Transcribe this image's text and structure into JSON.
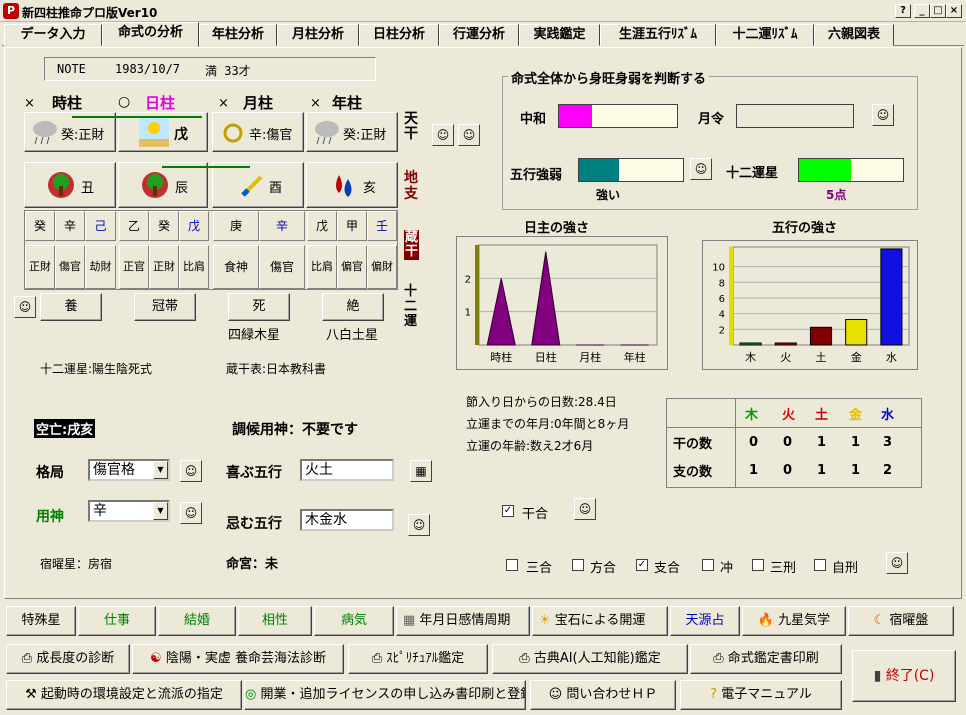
{
  "window": {
    "title": "新四柱推命プロ版Ver10",
    "help": "?",
    "min": "_",
    "max": "□",
    "close": "×",
    "app_icon": "P"
  },
  "tabs": [
    "データ入力",
    "命式の分析",
    "年柱分析",
    "月柱分析",
    "日柱分析",
    "行運分析",
    "実践鑑定",
    "生涯五行ﾘｽﾞﾑ",
    "十二運ﾘｽﾞﾑ",
    "六親図表"
  ],
  "note": {
    "label": "NOTE",
    "date": "1983/10/7",
    "age": "満 33才"
  },
  "pillars": {
    "marks": [
      "×",
      "○",
      "×",
      "×"
    ],
    "names": [
      "時柱",
      "日柱",
      "月柱",
      "年柱"
    ],
    "stems": [
      "癸:正財",
      "戊",
      "辛:傷官",
      "癸:正財"
    ],
    "branches": [
      "丑",
      "辰",
      "酉",
      "亥"
    ],
    "hidden": [
      [
        "癸",
        "辛",
        "己"
      ],
      [
        "乙",
        "癸",
        "戊"
      ],
      [
        "庚",
        "辛"
      ],
      [
        "戊",
        "甲",
        "壬"
      ]
    ],
    "hidden_gods": [
      [
        "正財",
        "傷官",
        "劫財"
      ],
      [
        "正官",
        "正財",
        "比肩"
      ],
      [
        "食神",
        "傷官"
      ],
      [
        "比肩",
        "偏官",
        "偏財"
      ]
    ],
    "twelve": [
      "養",
      "冠帯",
      "死",
      "絶"
    ],
    "stars": [
      "",
      "",
      "四緑木星",
      "八白土星"
    ]
  },
  "side_labels": {
    "tenkan": "天\n干",
    "chishi": "地\n支",
    "zoukan": "蔵\n干",
    "juuni": "十\n二\n運"
  },
  "meta": {
    "twelve_type": "十二運星:陽生陰死式",
    "zoukan_table": "蔵干表:日本教科書"
  },
  "strength_box": {
    "title": "命式全体から身旺身弱を判断する",
    "chuwa": "中和",
    "gatsurei": "月令",
    "gogyo_label": "五行強弱",
    "gogyo_value": "強い",
    "twelve_label": "十二運星",
    "twelve_value": "5点",
    "chuwa_fill": 0.28,
    "gatsurei_fill": 0.0,
    "gogyo_fill": 0.38,
    "twelve_fill": 0.5
  },
  "chart_data": [
    {
      "type": "area",
      "title": "日主の強さ",
      "categories": [
        "時柱",
        "日柱",
        "月柱",
        "年柱"
      ],
      "values": [
        2,
        2.8,
        0,
        0
      ],
      "yticks": [
        1,
        2
      ],
      "ylim": [
        0,
        3
      ]
    },
    {
      "type": "bar",
      "title": "五行の強さ",
      "categories": [
        "木",
        "火",
        "土",
        "金",
        "水"
      ],
      "values": [
        0,
        0,
        2,
        3,
        12
      ],
      "colors": [
        "#00a000",
        "#c00000",
        "#800000",
        "#e8e000",
        "#1010e0"
      ],
      "yticks": [
        2,
        4,
        6,
        8,
        10
      ],
      "ylim": [
        0,
        12.5
      ]
    }
  ],
  "info": {
    "setsu": "節入り日からの日数:28.4日",
    "ritsuun": "立運までの年月:0年間と8ヶ月",
    "ritsuun_age": "立運の年齢:数え2才6月"
  },
  "gogyo_table": {
    "headers": [
      "木",
      "火",
      "土",
      "金",
      "水"
    ],
    "header_colors": [
      "#00a000",
      "#e00000",
      "#c00000",
      "#e0c000",
      "#0000e0"
    ],
    "row1_label": "干の数",
    "row1": [
      "0",
      "0",
      "1",
      "1",
      "3"
    ],
    "row2_label": "支の数",
    "row2": [
      "1",
      "0",
      "1",
      "1",
      "2"
    ]
  },
  "kuubou": "空亡:戌亥",
  "choukou": "調候用神：不要です",
  "kakkyoku": {
    "label": "格局",
    "value": "傷官格"
  },
  "youjin": {
    "label": "用神",
    "value": "辛"
  },
  "yorokobu": {
    "label": "喜ぶ五行",
    "value": "火土"
  },
  "imu": {
    "label": "忌む五行",
    "value": "木金水"
  },
  "shukuyo": "宿曜星：房宿",
  "meikyu": "命宮：未",
  "kango": "干合",
  "checks": [
    {
      "label": "三合",
      "checked": false
    },
    {
      "label": "方合",
      "checked": false
    },
    {
      "label": "支合",
      "checked": true
    },
    {
      "label": "冲",
      "checked": false
    },
    {
      "label": "三刑",
      "checked": false
    },
    {
      "label": "自刑",
      "checked": false
    }
  ],
  "bottom": {
    "row1": [
      "特殊星",
      "仕事",
      "結婚",
      "相性",
      "病気",
      "年月日感情周期",
      "宝石による開運",
      "天源占",
      "九星気学",
      "宿曜盤"
    ],
    "row2": [
      "成長度の診断",
      "陰陽・実虚 養命芸海法診断",
      "ｽﾋﾟﾘﾁｭｱﾙ鑑定",
      "古典AI(人工知能)鑑定",
      "命式鑑定書印刷"
    ],
    "row3": [
      "起動時の環境設定と流派の指定",
      "開業・追加ライセンスの申し込み書印刷と登録",
      "問い合わせＨＰ",
      "電子マニュアル"
    ],
    "exit": "終了(C)"
  }
}
